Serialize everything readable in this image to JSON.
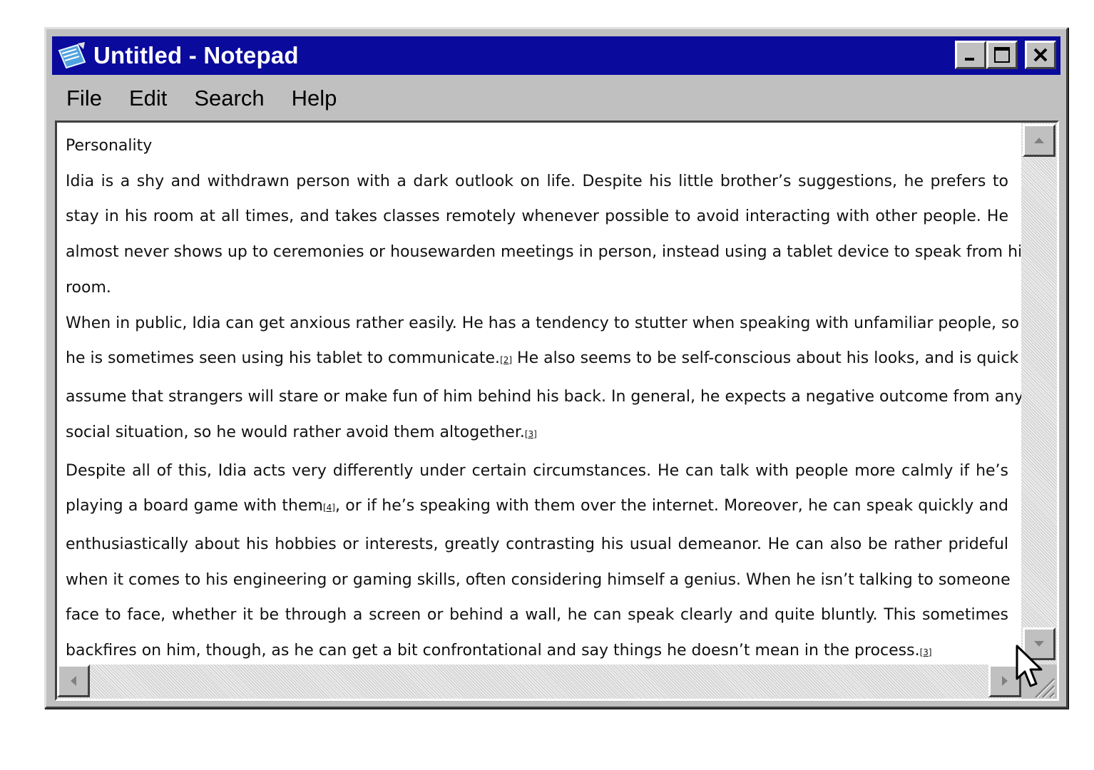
{
  "window": {
    "title": "Untitled - Notepad",
    "icon": "notepad-icon"
  },
  "controls": {
    "minimize": "minimize-icon",
    "maximize": "maximize-icon",
    "close": "close-icon"
  },
  "menu": {
    "items": [
      "File",
      "Edit",
      "Search",
      "Help"
    ]
  },
  "document": {
    "lines": [
      {
        "text": "Personality",
        "ref": ""
      },
      {
        "text": "Idia is a shy and withdrawn person with a dark outlook on life. Despite his little brother’s suggestions, he prefers to",
        "ref": ""
      },
      {
        "text": "stay in his room at all times, and takes classes remotely whenever possible to avoid interacting with other people. He",
        "ref": ""
      },
      {
        "text": "almost never shows up to ceremonies or housewarden meetings in person, instead using a tablet device to speak from his",
        "ref": ""
      },
      {
        "text": "room.",
        "ref": ""
      },
      {
        "text": "When in public, Idia can get anxious rather easily. He has a tendency to stutter when speaking with unfamiliar people, so",
        "ref": ""
      },
      {
        "text": "he is sometimes seen using his tablet to communicate.",
        "ref": "[2]",
        "after": " He also seems to be self-conscious about his looks, and is quick to"
      },
      {
        "text": "assume that strangers will stare or make fun of him behind his back. In general, he expects a negative outcome from any",
        "ref": ""
      },
      {
        "text": "social situation, so he would rather avoid them altogether.",
        "ref": "[3]"
      },
      {
        "text": "Despite all of this, Idia acts very differently under certain circumstances. He can talk with people more calmly if he’s",
        "ref": ""
      },
      {
        "text": "playing a board game with them",
        "ref": "[4]",
        "after": ", or if he’s speaking with them over the internet. Moreover, he can speak quickly and"
      },
      {
        "text": "enthusiastically about his hobbies or interests, greatly contrasting his usual demeanor. He can also be rather prideful",
        "ref": ""
      },
      {
        "text": "when it comes to his engineering or gaming skills, often considering himself a genius. When he isn’t talking to someone",
        "ref": ""
      },
      {
        "text": "face to face, whether it be through a screen or behind a wall, he can speak clearly and quite bluntly. This sometimes",
        "ref": ""
      },
      {
        "text": "backfires on him, though, as he can get a bit confrontational and say things he doesn’t mean in the process.",
        "ref": "[3]"
      }
    ]
  },
  "scrollbars": {
    "up": "scroll-up-arrow-icon",
    "down": "scroll-down-arrow-icon",
    "left": "scroll-left-arrow-icon",
    "right": "scroll-right-arrow-icon"
  },
  "cursor": "mouse-pointer-icon"
}
